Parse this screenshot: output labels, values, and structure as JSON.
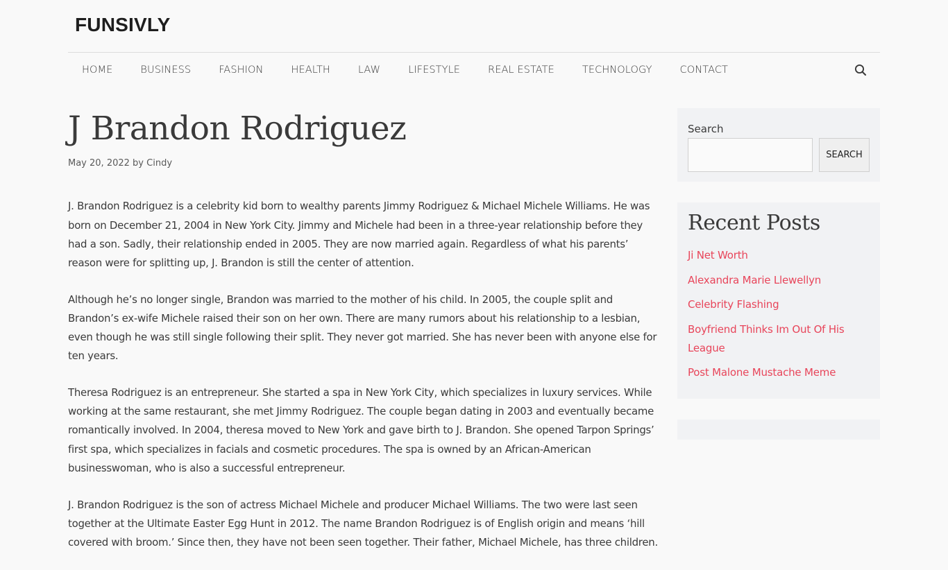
{
  "site": {
    "title": "FUNSIVLY"
  },
  "nav": {
    "items": [
      "HOME",
      "BUSINESS",
      "FASHION",
      "HEALTH",
      "LAW",
      "LIFESTYLE",
      "REAL ESTATE",
      "TECHNOLOGY",
      "CONTACT"
    ],
    "search_icon": "search-icon"
  },
  "post": {
    "title": "J Brandon Rodriguez",
    "date": "May 20, 2022",
    "by": "by",
    "author": "Cindy",
    "paragraphs": [
      "J. Brandon Rodriguez is a celebrity kid born to wealthy parents Jimmy Rodriguez & Michael Michele Williams. He was born on December 21, 2004 in New York City. Jimmy and Michele had been in a three-year relationship before they had a son. Sadly, their relationship ended in 2005. They are now married again. Regardless of what his parents’ reason were for splitting up, J. Brandon is still the center of attention.",
      "Although he’s no longer single, Brandon was married to the mother of his child. In 2005, the couple split and Brandon’s ex-wife Michele raised their son on her own. There are many rumors about his relationship to a lesbian, even though he was still single following their split. They never got married. She has never been with anyone else for ten years.",
      "Theresa Rodriguez is an entrepreneur. She started a spa in New York City, which specializes in luxury services. While working at the same restaurant, she met Jimmy Rodriguez. The couple began dating in 2003 and eventually became romantically involved. In 2004, theresa moved to New York and gave birth to J. Brandon. She opened Tarpon Springs’ first spa, which specializes in facials and cosmetic procedures. The spa is owned by an African-American businesswoman, who is also a successful entrepreneur.",
      "J. Brandon Rodriguez is the son of actress Michael Michele and producer Michael Williams. The two were last seen together at the Ultimate Easter Egg Hunt in 2012. The name Brandon Rodriguez is of English origin and means ‘hill covered with broom.’ Since then, they have not been seen together. Their father, Michael Michele, has three children."
    ]
  },
  "sidebar": {
    "search": {
      "label": "Search",
      "button": "SEARCH",
      "value": ""
    },
    "recent": {
      "title": "Recent Posts",
      "posts": [
        "Ji Net Worth",
        "Alexandra Marie Llewellyn",
        "Celebrity Flashing",
        "Boyfriend Thinks Im Out Of His League",
        "Post Malone Mustache Meme"
      ]
    }
  },
  "colors": {
    "link": "#e8455a",
    "text": "#3a3a3a",
    "background": "#f9f9f9",
    "widget_bg": "#f1f2f4"
  }
}
